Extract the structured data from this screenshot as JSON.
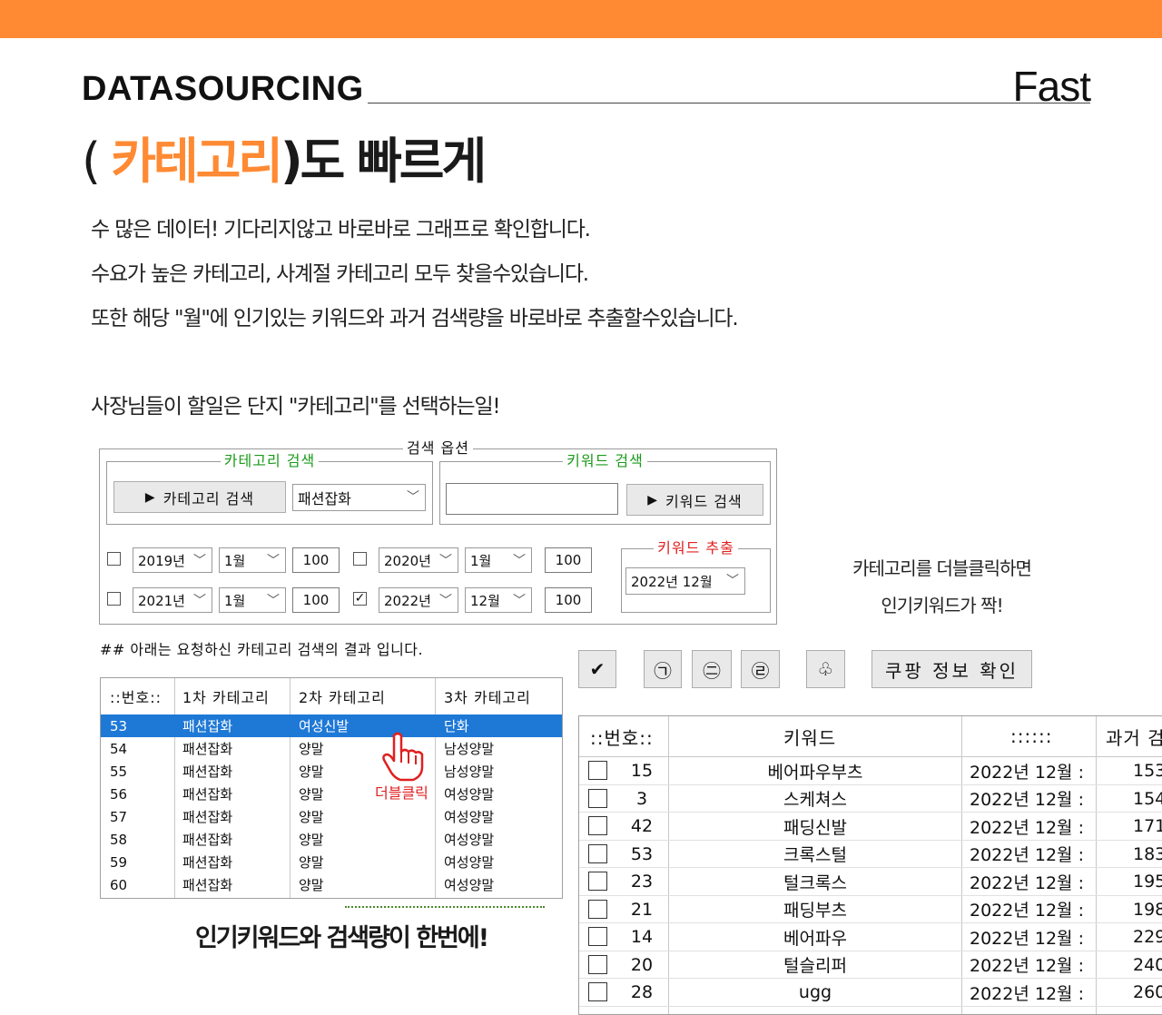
{
  "header": {
    "brand": "DATASOURCING",
    "tagline": "Fast",
    "headline_open": "( ",
    "headline_accent": "카테고리",
    "headline_close": ")도 빠르게",
    "desc": [
      "수 많은 데이터! 기다리지않고 바로바로 그래프로 확인합니다.",
      "수요가 높은 카테고리, 사계절 카테고리 모두 찾을수있습니다.",
      "또한 해당 \"월\"에 인기있는 키워드와 과거 검색량을 바로바로 추출할수있습니다."
    ],
    "boss_note": "사장님들이 할일은 단지 \"카테고리\"를 선택하는일!"
  },
  "form": {
    "options_legend": "검색 옵션",
    "category_legend": "카테고리 검색",
    "category_button": "카테고리 검색",
    "category_combo": "패션잡화",
    "keyword_legend": "키워드 검색",
    "keyword_input": "",
    "keyword_button": "키워드 검색",
    "extract_legend": "키워드 추출",
    "extract_combo": "2022년 12월",
    "period_rows": [
      {
        "a_checked": false,
        "a_year": "2019년",
        "a_month": "1월",
        "a_count": "100",
        "b_checked": false,
        "b_year": "2020년",
        "b_month": "1월",
        "b_count": "100"
      },
      {
        "a_checked": false,
        "a_year": "2021년",
        "a_month": "1월",
        "a_count": "100",
        "b_checked": true,
        "b_year": "2022년",
        "b_month": "12월",
        "b_count": "100"
      }
    ],
    "check_mark": "✓"
  },
  "result_note": "## 아래는 요청하신 카테고리 검색의 결과 입니다.",
  "category_grid": {
    "headers": [
      "::번호::",
      "1차 카테고리",
      "2차 카테고리",
      "3차 카테고리"
    ],
    "rows": [
      [
        "53",
        "패션잡화",
        "여성신발",
        "단화"
      ],
      [
        "54",
        "패션잡화",
        "양말",
        "남성양말"
      ],
      [
        "55",
        "패션잡화",
        "양말",
        "남성양말"
      ],
      [
        "56",
        "패션잡화",
        "양말",
        "여성양말"
      ],
      [
        "57",
        "패션잡화",
        "양말",
        "여성양말"
      ],
      [
        "58",
        "패션잡화",
        "양말",
        "여성양말"
      ],
      [
        "59",
        "패션잡화",
        "양말",
        "여성양말"
      ],
      [
        "60",
        "패션잡화",
        "양말",
        "여성양말"
      ]
    ],
    "selected_row": 0,
    "double_click_label": "더블클릭"
  },
  "caption_bottom": "인기키워드와 검색량이 한번에!",
  "side_note": [
    "카테고리를 더블클릭하면",
    "인기키워드가 짝!"
  ],
  "toolbar": {
    "check_glyph": "✔",
    "btn1_glyph": "㉠",
    "btn2_glyph": "㊁",
    "btn3_glyph": "㉣",
    "btn4_glyph": "♧",
    "coupang_label": "쿠팡 정보 확인"
  },
  "keyword_grid": {
    "headers": [
      "::번호::",
      "키워드",
      "::::::",
      "과거 검"
    ],
    "rows": [
      [
        "15",
        "베어파우부츠",
        "2022년 12월 :",
        "153"
      ],
      [
        "3",
        "스케쳐스",
        "2022년 12월 :",
        "154"
      ],
      [
        "42",
        "패딩신발",
        "2022년 12월 :",
        "171"
      ],
      [
        "53",
        "크록스털",
        "2022년 12월 :",
        "183"
      ],
      [
        "23",
        "털크록스",
        "2022년 12월 :",
        "195"
      ],
      [
        "21",
        "패딩부츠",
        "2022년 12월 :",
        "198"
      ],
      [
        "14",
        "베어파우",
        "2022년 12월 :",
        "229"
      ],
      [
        "20",
        "털슬리퍼",
        "2022년 12월 :",
        "240"
      ],
      [
        "28",
        "ugg",
        "2022년 12월 :",
        "260"
      ]
    ]
  },
  "colors": {
    "accent": "#ff8a33",
    "selection": "#1e78d6",
    "legend_green": "#1a9a1a",
    "legend_red": "#e02020"
  }
}
